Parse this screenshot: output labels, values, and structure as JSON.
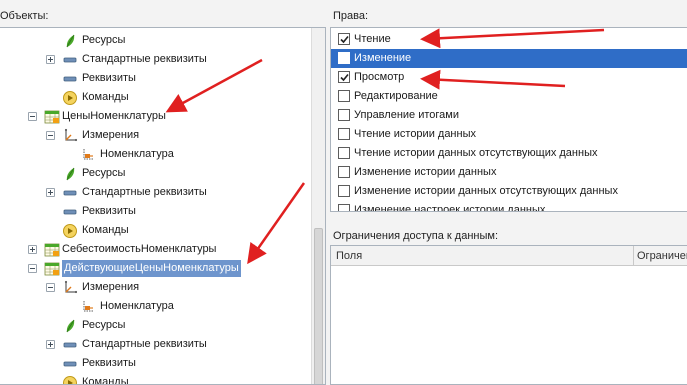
{
  "objects_label": "Объекты:",
  "rights_label": "Права:",
  "tree": [
    {
      "label": "Ресурсы",
      "icon": "resource-icon",
      "expander": "none"
    },
    {
      "label": "Стандартные реквизиты",
      "icon": "attribute-icon",
      "expander": "plus"
    },
    {
      "label": "Реквизиты",
      "icon": "attribute-icon",
      "expander": "none"
    },
    {
      "label": "Команды",
      "icon": "command-icon",
      "expander": "none"
    },
    {
      "label": "ЦеныНоменклатуры",
      "icon": "register-icon",
      "expander": "minus"
    },
    {
      "label": "Измерения",
      "icon": "dimension-icon",
      "expander": "minus"
    },
    {
      "label": "Номенклатура",
      "icon": "dimension-item-icon",
      "expander": "none"
    },
    {
      "label": "Ресурсы",
      "icon": "resource-icon",
      "expander": "none"
    },
    {
      "label": "Стандартные реквизиты",
      "icon": "attribute-icon",
      "expander": "plus"
    },
    {
      "label": "Реквизиты",
      "icon": "attribute-icon",
      "expander": "none"
    },
    {
      "label": "Команды",
      "icon": "command-icon",
      "expander": "none"
    },
    {
      "label": "СебестоимостьНоменклатуры",
      "icon": "register-icon",
      "expander": "plus"
    },
    {
      "label": "ДействующиеЦеныНоменклатуры",
      "icon": "register-icon",
      "expander": "minus",
      "selected": true
    },
    {
      "label": "Измерения",
      "icon": "dimension-icon",
      "expander": "minus"
    },
    {
      "label": "Номенклатура",
      "icon": "dimension-item-icon",
      "expander": "none"
    },
    {
      "label": "Ресурсы",
      "icon": "resource-icon",
      "expander": "none"
    },
    {
      "label": "Стандартные реквизиты",
      "icon": "attribute-icon",
      "expander": "plus"
    },
    {
      "label": "Реквизиты",
      "icon": "attribute-icon",
      "expander": "none"
    },
    {
      "label": "Команды",
      "icon": "command-icon",
      "expander": "none"
    }
  ],
  "rights": [
    {
      "label": "Чтение",
      "checked": true
    },
    {
      "label": "Изменение",
      "checked": false,
      "selected": true
    },
    {
      "label": "Просмотр",
      "checked": true
    },
    {
      "label": "Редактирование",
      "checked": false
    },
    {
      "label": "Управление итогами",
      "checked": false
    },
    {
      "label": "Чтение истории данных",
      "checked": false
    },
    {
      "label": "Чтение истории данных отсутствующих данных",
      "checked": false
    },
    {
      "label": "Изменение истории данных",
      "checked": false
    },
    {
      "label": "Изменение истории данных отсутствующих данных",
      "checked": false
    },
    {
      "label": "Изменение настроек истории данных",
      "checked": false
    }
  ],
  "restrict_label": "Ограничения доступа к данным:",
  "restrict_columns": [
    "Поля",
    "Ограничен"
  ],
  "colors": {
    "selection": "#2f6dc7",
    "tree_selection": "#6e95cd",
    "arrow": "#e02020"
  }
}
